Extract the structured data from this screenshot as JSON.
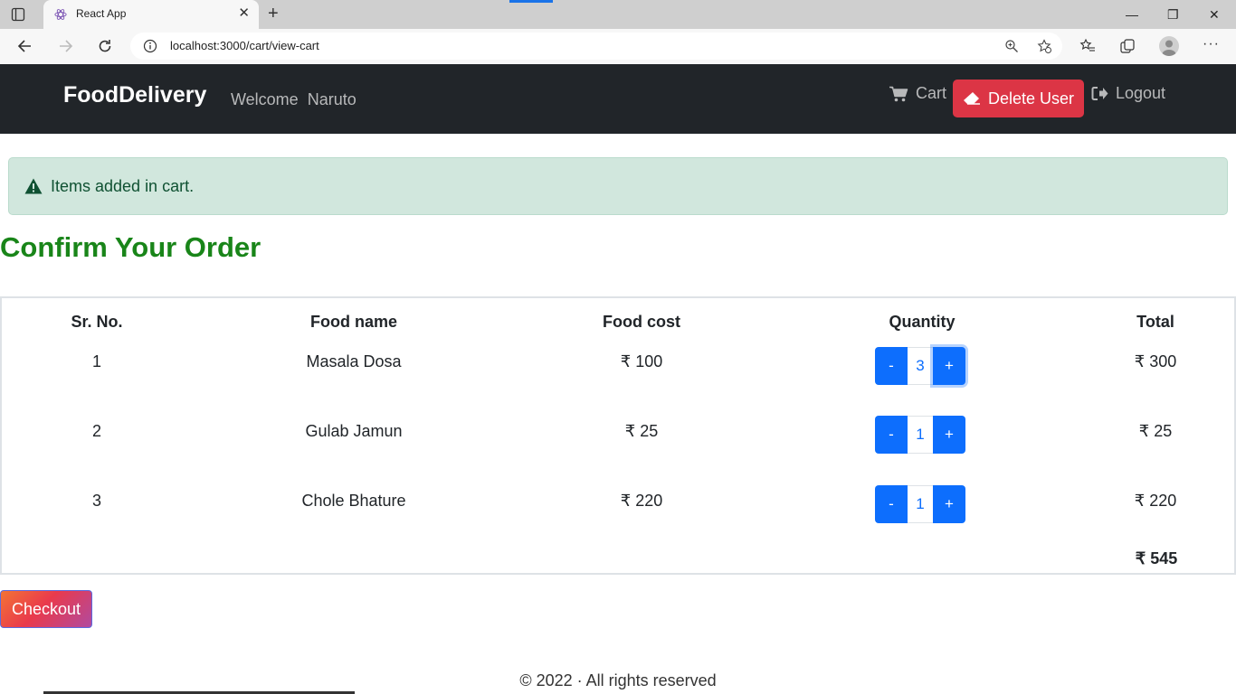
{
  "browser": {
    "tab_title": "React App",
    "tab_close": "✕",
    "new_tab": "+",
    "url": "localhost:3000/cart/view-cart",
    "more": "···",
    "window_buttons": {
      "minimize": "—",
      "restore": "❐",
      "close": "✕"
    }
  },
  "navbar": {
    "brand": "FoodDelivery",
    "welcome": "Welcome",
    "username": "Naruto",
    "cart_label": "Cart",
    "delete_label": "Delete User",
    "logout_label": "Logout"
  },
  "alert": {
    "message": "Items added in cart."
  },
  "page": {
    "heading": "Confirm Your Order"
  },
  "table": {
    "headers": [
      "Sr. No.",
      "Food name",
      "Food cost",
      "Quantity",
      "Total"
    ],
    "rows": [
      {
        "sr": "1",
        "name": "Masala Dosa",
        "cost": "₹ 100",
        "qty": "3",
        "total": "₹ 300"
      },
      {
        "sr": "2",
        "name": "Gulab Jamun",
        "cost": "₹ 25",
        "qty": "1",
        "total": "₹ 25"
      },
      {
        "sr": "3",
        "name": "Chole Bhature",
        "cost": "₹ 220",
        "qty": "1",
        "total": "₹ 220"
      }
    ],
    "minus": "-",
    "plus": "+",
    "grand_total": "₹ 545"
  },
  "checkout_label": "Checkout",
  "footer": "© 2022 · All rights reserved",
  "colors": {
    "navbar_bg": "#212529",
    "danger": "#dc3545",
    "primary": "#0d6efd",
    "heading_green": "#198519",
    "alert_bg": "#d1e7dd"
  }
}
